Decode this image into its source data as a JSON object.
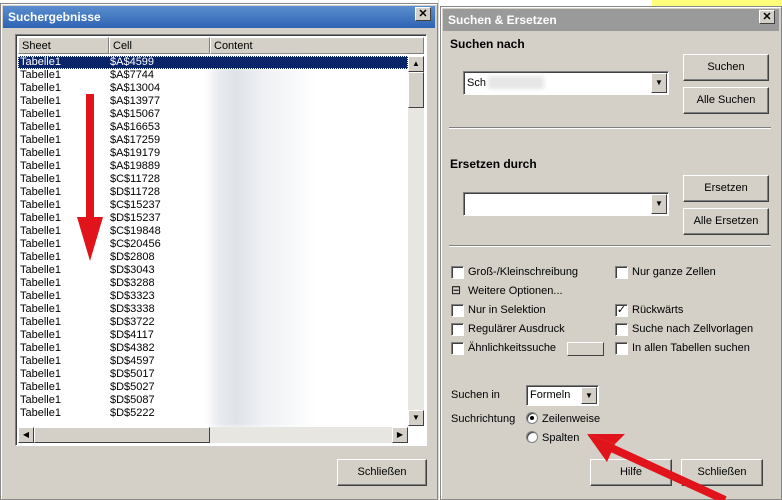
{
  "results": {
    "title": "Suchergebnisse",
    "close_glyph": "✕",
    "columns": [
      "Sheet",
      "Cell",
      "Content"
    ],
    "rows": [
      {
        "sheet": "Tabelle1",
        "cell": "$A$4599"
      },
      {
        "sheet": "Tabelle1",
        "cell": "$A$7744"
      },
      {
        "sheet": "Tabelle1",
        "cell": "$A$13004"
      },
      {
        "sheet": "Tabelle1",
        "cell": "$A$13977"
      },
      {
        "sheet": "Tabelle1",
        "cell": "$A$15067"
      },
      {
        "sheet": "Tabelle1",
        "cell": "$A$16653"
      },
      {
        "sheet": "Tabelle1",
        "cell": "$A$17259"
      },
      {
        "sheet": "Tabelle1",
        "cell": "$A$19179"
      },
      {
        "sheet": "Tabelle1",
        "cell": "$A$19889"
      },
      {
        "sheet": "Tabelle1",
        "cell": "$C$11728"
      },
      {
        "sheet": "Tabelle1",
        "cell": "$D$11728"
      },
      {
        "sheet": "Tabelle1",
        "cell": "$C$15237"
      },
      {
        "sheet": "Tabelle1",
        "cell": "$D$15237"
      },
      {
        "sheet": "Tabelle1",
        "cell": "$C$19848"
      },
      {
        "sheet": "Tabelle1",
        "cell": "$C$20456"
      },
      {
        "sheet": "Tabelle1",
        "cell": "$D$2808"
      },
      {
        "sheet": "Tabelle1",
        "cell": "$D$3043"
      },
      {
        "sheet": "Tabelle1",
        "cell": "$D$3288"
      },
      {
        "sheet": "Tabelle1",
        "cell": "$D$3323"
      },
      {
        "sheet": "Tabelle1",
        "cell": "$D$3338"
      },
      {
        "sheet": "Tabelle1",
        "cell": "$D$3722"
      },
      {
        "sheet": "Tabelle1",
        "cell": "$D$4117"
      },
      {
        "sheet": "Tabelle1",
        "cell": "$D$4382"
      },
      {
        "sheet": "Tabelle1",
        "cell": "$D$4597"
      },
      {
        "sheet": "Tabelle1",
        "cell": "$D$5017"
      },
      {
        "sheet": "Tabelle1",
        "cell": "$D$5027"
      },
      {
        "sheet": "Tabelle1",
        "cell": "$D$5087"
      },
      {
        "sheet": "Tabelle1",
        "cell": "$D$5222"
      }
    ],
    "selected_index": 0,
    "close_button": "Schließen",
    "arrow_color": "#e0141a"
  },
  "find_replace": {
    "title": "Suchen & Ersetzen",
    "close_glyph": "✕",
    "search_label": "Suchen nach",
    "search_value": "Sch",
    "search_button": "Suchen",
    "search_all_button": "Alle Suchen",
    "replace_label": "Ersetzen durch",
    "replace_value": "",
    "replace_button": "Ersetzen",
    "replace_all_button": "Alle Ersetzen",
    "options": {
      "match_case": {
        "label": "Groß-/Kleinschreibung",
        "checked": false
      },
      "whole_cells": {
        "label": "Nur ganze Zellen",
        "checked": false
      },
      "more_options": {
        "label": "Weitere Optionen...",
        "glyph": "⊟"
      },
      "selection_only": {
        "label": "Nur in Selektion",
        "checked": false
      },
      "backwards": {
        "label": "Rückwärts",
        "checked": true
      },
      "regex": {
        "label": "Regulärer Ausdruck",
        "checked": false
      },
      "cell_styles": {
        "label": "Suche nach Zellvorlagen",
        "checked": false
      },
      "similarity": {
        "label": "Ähnlichkeitssuche",
        "checked": false
      },
      "all_sheets": {
        "label": "In allen Tabellen suchen",
        "checked": false
      }
    },
    "search_in_label": "Suchen in",
    "search_in_value": "Formeln",
    "direction_label": "Suchrichtung",
    "direction_rows": "Zeilenweise",
    "direction_columns": "Spalten",
    "direction_selected": "rows",
    "help_button": "Hilfe",
    "close_button": "Schließen",
    "check_glyph": "✓"
  }
}
